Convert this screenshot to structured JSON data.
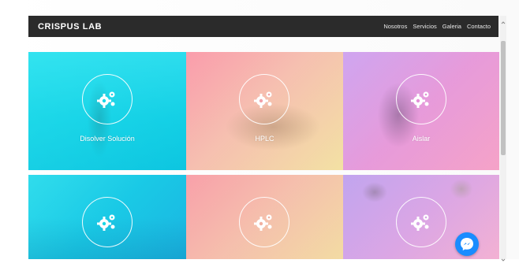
{
  "nav": {
    "brand": "CRISPUS LAB",
    "links": [
      "Nosotros",
      "Servicios",
      "Galeria",
      "Contacto"
    ]
  },
  "tiles": [
    {
      "label": "Disolver Solución",
      "icon": "gears-icon",
      "overlay": "#1ad7e6"
    },
    {
      "label": "HPLC",
      "icon": "gears-icon",
      "overlay": "#f2a0a8"
    },
    {
      "label": "Aislar",
      "icon": "gears-icon",
      "overlay": "#e48fd8"
    },
    {
      "label": "",
      "icon": "gears-icon",
      "overlay": "#1ad7e6"
    },
    {
      "label": "",
      "icon": "gears-icon",
      "overlay": "#f2b0a0"
    },
    {
      "label": "",
      "icon": "gears-icon",
      "overlay": "#d8a6e6"
    }
  ],
  "messenger": {
    "icon": "messenger-icon",
    "color": "#1a8cff"
  }
}
